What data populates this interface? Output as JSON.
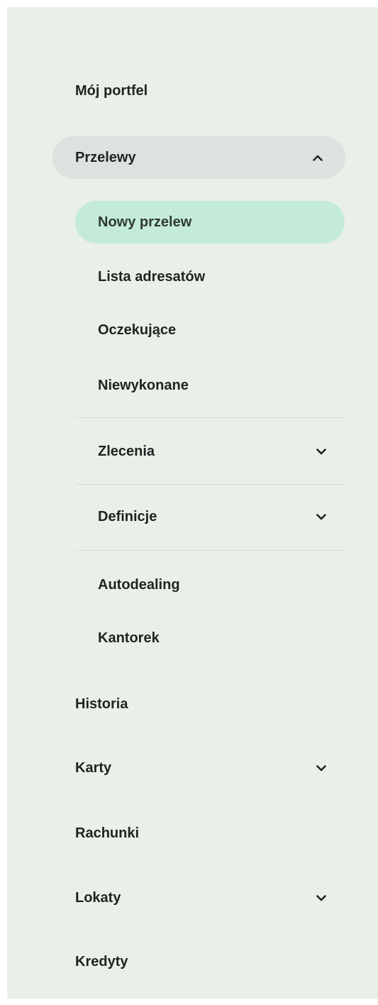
{
  "nav": {
    "portfolio": "Mój portfel",
    "transfers": {
      "label": "Przelewy",
      "expanded": true,
      "items": {
        "new_transfer": "Nowy przelew",
        "recipients": "Lista adresatów",
        "pending": "Oczekujące",
        "failed": "Niewykonane",
        "orders": "Zlecenia",
        "definitions": "Definicje",
        "autodealing": "Autodealing",
        "kantorek": "Kantorek"
      }
    },
    "history": "Historia",
    "cards": "Karty",
    "accounts": "Rachunki",
    "deposits": "Lokaty",
    "loans": "Kredyty"
  },
  "colors": {
    "sidebar_bg": "#e9efe9",
    "parent_pill": "#dde2de",
    "active_pill": "#c4ebd8",
    "text": "#1f2421"
  }
}
